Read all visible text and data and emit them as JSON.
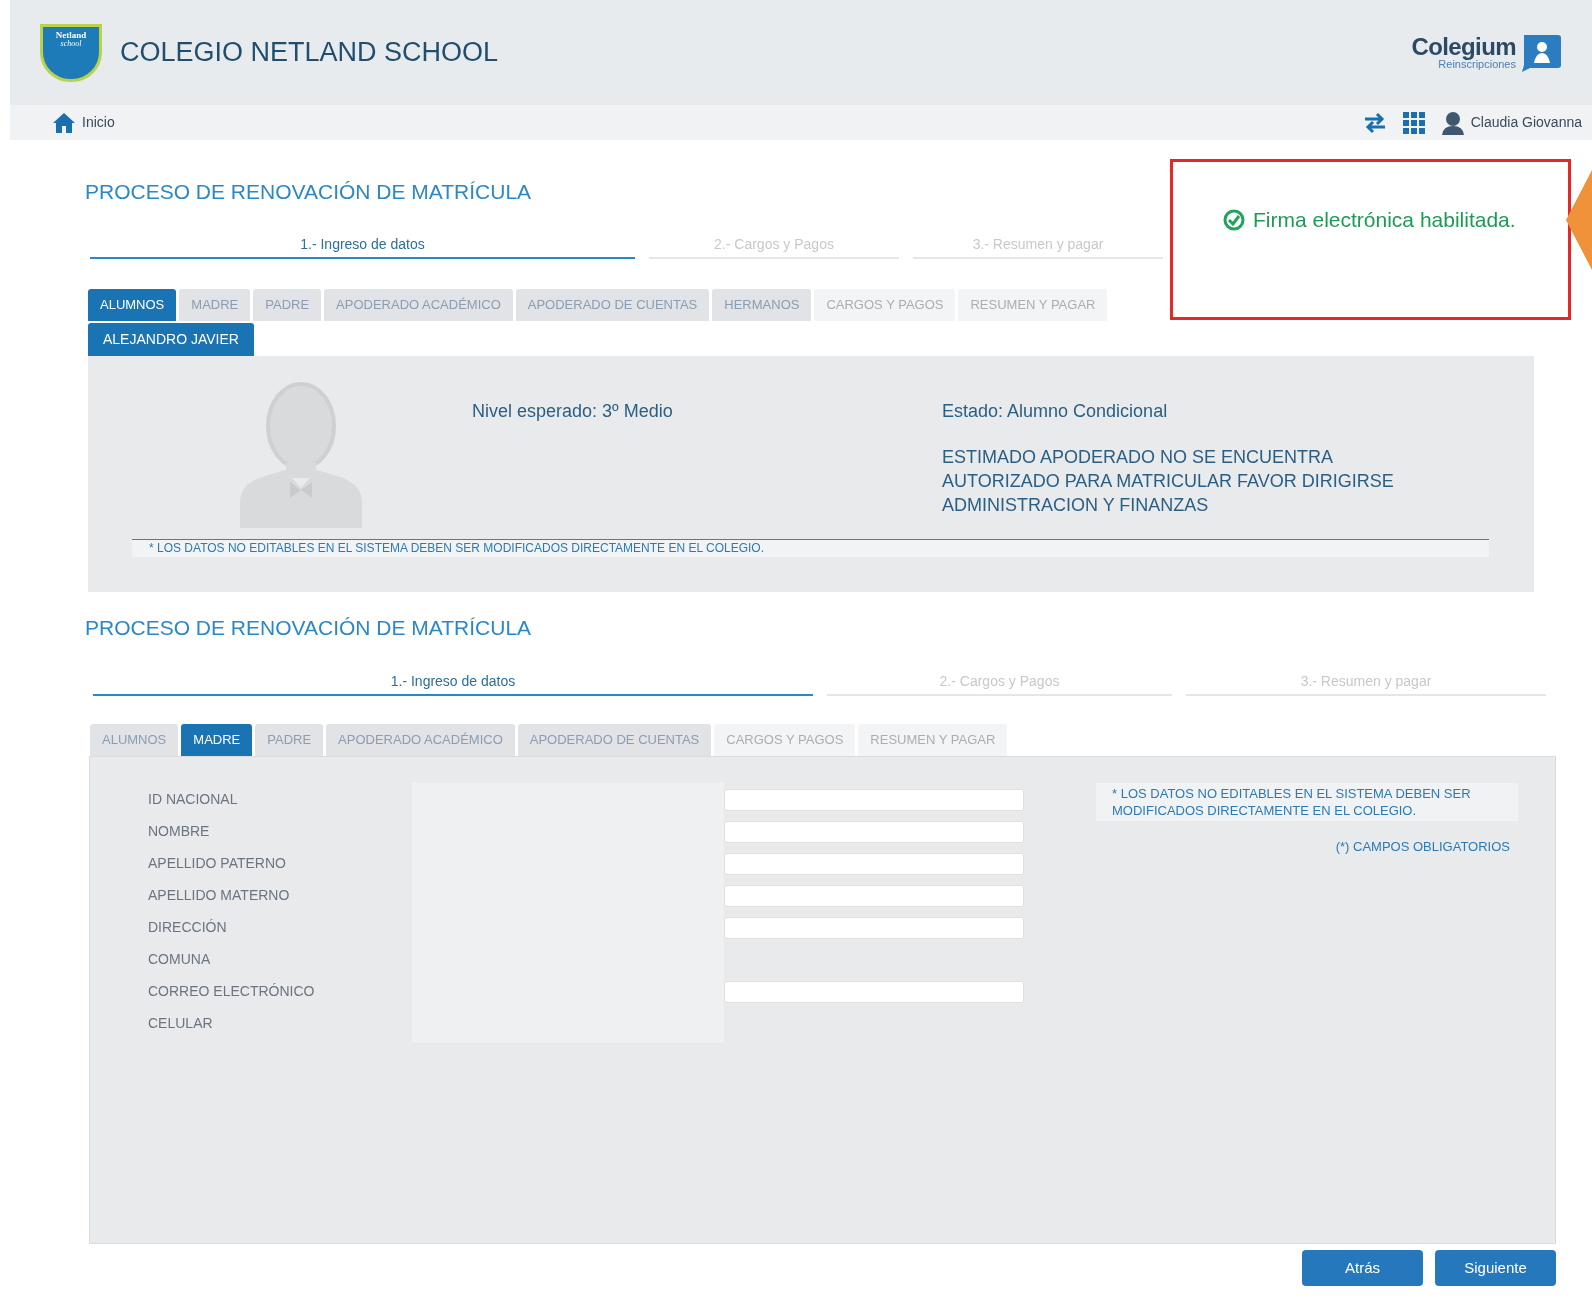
{
  "header": {
    "school_name": "COLEGIO NETLAND SCHOOL",
    "logo_text": "Netland",
    "logo_subtext": "school",
    "brand": "Colegium",
    "brand_sub": "Reinscripciones"
  },
  "nav": {
    "home": "Inicio",
    "user": "Claudia Giovanna"
  },
  "notice": {
    "text": "Firma electrónica habilitada."
  },
  "screen_1": {
    "title": "PROCESO DE RENOVACIÓN DE MATRÍCULA",
    "steps": [
      {
        "label": "1.- Ingreso de datos",
        "selected": true
      },
      {
        "label": "2.- Cargos y Pagos",
        "selected": false
      },
      {
        "label": "3.- Resumen y pagar",
        "selected": false
      }
    ],
    "tabs": [
      {
        "label": "ALUMNOS",
        "selected": true,
        "disabled": false
      },
      {
        "label": "MADRE",
        "selected": false,
        "disabled": false
      },
      {
        "label": "PADRE",
        "selected": false,
        "disabled": false
      },
      {
        "label": "APODERADO ACADÉMICO",
        "selected": false,
        "disabled": false
      },
      {
        "label": "APODERADO DE CUENTAS",
        "selected": false,
        "disabled": false
      },
      {
        "label": "HERMANOS",
        "selected": false,
        "disabled": false
      },
      {
        "label": "CARGOS Y PAGOS",
        "selected": false,
        "disabled": true
      },
      {
        "label": "RESUMEN Y PAGAR",
        "selected": false,
        "disabled": true
      }
    ],
    "student_tab": "ALEJANDRO JAVIER",
    "level": "Nivel esperado: 3º Medio",
    "status": "Estado: Alumno Condicional",
    "message": "ESTIMADO APODERADO NO SE ENCUENTRA AUTORIZADO PARA MATRICULAR FAVOR DIRIGIRSE ADMINISTRACION Y FINANZAS",
    "note": "* LOS DATOS NO EDITABLES EN EL SISTEMA DEBEN SER MODIFICADOS DIRECTAMENTE EN EL COLEGIO."
  },
  "screen_2": {
    "title": "PROCESO DE RENOVACIÓN DE MATRÍCULA",
    "steps": [
      {
        "label": "1.- Ingreso de datos",
        "selected": true
      },
      {
        "label": "2.- Cargos y Pagos",
        "selected": false
      },
      {
        "label": "3.- Resumen y pagar",
        "selected": false
      }
    ],
    "tabs": [
      {
        "label": "ALUMNOS",
        "selected": false,
        "disabled": false
      },
      {
        "label": "MADRE",
        "selected": true,
        "disabled": false
      },
      {
        "label": "PADRE",
        "selected": false,
        "disabled": false
      },
      {
        "label": "APODERADO ACADÉMICO",
        "selected": false,
        "disabled": false
      },
      {
        "label": "APODERADO DE CUENTAS",
        "selected": false,
        "disabled": false
      },
      {
        "label": "CARGOS Y PAGOS",
        "selected": false,
        "disabled": true
      },
      {
        "label": "RESUMEN Y PAGAR",
        "selected": false,
        "disabled": true
      }
    ],
    "fields": [
      {
        "label": "ID NACIONAL",
        "kind": "input"
      },
      {
        "label": "NOMBRE",
        "kind": "input"
      },
      {
        "label": "APELLIDO PATERNO",
        "kind": "input"
      },
      {
        "label": "APELLIDO MATERNO",
        "kind": "input"
      },
      {
        "label": "DIRECCIÓN",
        "kind": "input"
      },
      {
        "label": "COMUNA",
        "kind": "none"
      },
      {
        "label": "CORREO ELECTRÓNICO",
        "kind": "input"
      },
      {
        "label": "CELULAR",
        "kind": "none"
      }
    ],
    "note": "* LOS DATOS NO EDITABLES EN EL SISTEMA DEBEN SER MODIFICADOS DIRECTAMENTE EN EL COLEGIO.",
    "required_note": "(*) CAMPOS OBLIGATORIOS",
    "buttons": [
      "Atrás",
      "Siguiente"
    ]
  }
}
